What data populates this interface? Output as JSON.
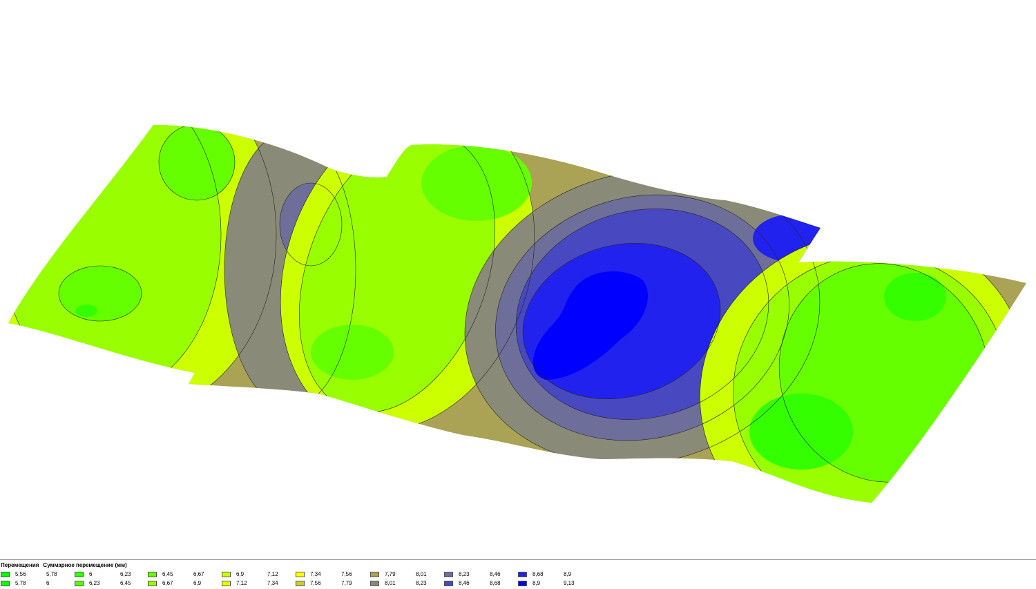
{
  "legend": {
    "title_category": "Перемещения",
    "title_quantity": "Суммарное перемещение (мм)",
    "row1": [
      {
        "from": "5,56",
        "to": "5,78",
        "color": "#00ff00"
      },
      {
        "from": "6",
        "to": "6,23",
        "color": "#33ff00"
      },
      {
        "from": "6,45",
        "to": "6,67",
        "color": "#66ff00"
      },
      {
        "from": "6,9",
        "to": "7,12",
        "color": "#ccff00"
      },
      {
        "from": "7,34",
        "to": "7,56",
        "color": "#ffff00"
      },
      {
        "from": "7,79",
        "to": "8,01",
        "color": "#aaa255"
      },
      {
        "from": "8,23",
        "to": "8,46",
        "color": "#6e6e9a"
      },
      {
        "from": "8,68",
        "to": "8,9",
        "color": "#2222ee"
      }
    ],
    "row2": [
      {
        "from": "5,78",
        "to": "6",
        "color": "#11ff00"
      },
      {
        "from": "6,23",
        "to": "6,45",
        "color": "#55ff00"
      },
      {
        "from": "6,67",
        "to": "6,9",
        "color": "#99ff00"
      },
      {
        "from": "7,12",
        "to": "7,34",
        "color": "#eeff00"
      },
      {
        "from": "7,56",
        "to": "7,79",
        "color": "#cccc33"
      },
      {
        "from": "8,01",
        "to": "8,23",
        "color": "#8a8a78"
      },
      {
        "from": "8,46",
        "to": "8,68",
        "color": "#4848c0"
      },
      {
        "from": "8,9",
        "to": "9,13",
        "color": "#0000ff"
      }
    ]
  }
}
